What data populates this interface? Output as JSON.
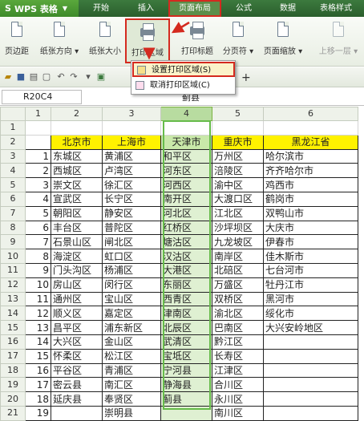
{
  "app": {
    "logo": "S",
    "name": "WPS 表格"
  },
  "menu_tabs": [
    "开始",
    "插入",
    "页面布局",
    "公式",
    "数据",
    "表格样式"
  ],
  "ribbon": {
    "buttons": [
      {
        "name": "page-margin",
        "label": "页边距"
      },
      {
        "name": "paper-orientation",
        "label": "纸张方向"
      },
      {
        "name": "paper-size",
        "label": "纸张大小"
      },
      {
        "name": "print-area",
        "label": "打印区域"
      },
      {
        "name": "print-title",
        "label": "打印标题"
      },
      {
        "name": "page-break",
        "label": "分页符"
      },
      {
        "name": "page-zoom",
        "label": "页面缩放"
      },
      {
        "name": "move-up",
        "label": "上移一层"
      }
    ]
  },
  "dropdown": {
    "set_area": "设置打印区域(S)",
    "cancel_area": "取消打印区域(C)"
  },
  "toolbar": {
    "tab_plus": "+"
  },
  "formula_bar": {
    "name_box": "R20C4",
    "value": "蓟县"
  },
  "sheet": {
    "col_headers": [
      "1",
      "2",
      "3",
      "4",
      "5",
      "6"
    ],
    "header_row": [
      "北京市",
      "上海市",
      "天津市",
      "重庆市",
      "黑龙江省"
    ],
    "rows": [
      [
        "1",
        "东城区",
        "黄浦区",
        "和平区",
        "万州区",
        "哈尔滨市"
      ],
      [
        "2",
        "西城区",
        "卢湾区",
        "河东区",
        "涪陵区",
        "齐齐哈尔市"
      ],
      [
        "3",
        "崇文区",
        "徐汇区",
        "河西区",
        "渝中区",
        "鸡西市"
      ],
      [
        "4",
        "宣武区",
        "长宁区",
        "南开区",
        "大渡口区",
        "鹤岗市"
      ],
      [
        "5",
        "朝阳区",
        "静安区",
        "河北区",
        "江北区",
        "双鸭山市"
      ],
      [
        "6",
        "丰台区",
        "普陀区",
        "红桥区",
        "沙坪坝区",
        "大庆市"
      ],
      [
        "7",
        "石景山区",
        "闸北区",
        "塘沽区",
        "九龙坡区",
        "伊春市"
      ],
      [
        "8",
        "海淀区",
        "虹口区",
        "汉沽区",
        "南岸区",
        "佳木斯市"
      ],
      [
        "9",
        "门头沟区",
        "杨浦区",
        "大港区",
        "北碚区",
        "七台河市"
      ],
      [
        "10",
        "房山区",
        "闵行区",
        "东丽区",
        "万盛区",
        "牡丹江市"
      ],
      [
        "11",
        "通州区",
        "宝山区",
        "西青区",
        "双桥区",
        "黑河市"
      ],
      [
        "12",
        "顺义区",
        "嘉定区",
        "津南区",
        "渝北区",
        "绥化市"
      ],
      [
        "13",
        "昌平区",
        "浦东新区",
        "北辰区",
        "巴南区",
        "大兴安岭地区"
      ],
      [
        "14",
        "大兴区",
        "金山区",
        "武清区",
        "黔江区",
        ""
      ],
      [
        "15",
        "怀柔区",
        "松江区",
        "宝坻区",
        "长寿区",
        ""
      ],
      [
        "16",
        "平谷区",
        "青浦区",
        "宁河县",
        "江津区",
        ""
      ],
      [
        "17",
        "密云县",
        "南汇区",
        "静海县",
        "合川区",
        ""
      ],
      [
        "18",
        "延庆县",
        "奉贤区",
        "蓟县",
        "永川区",
        ""
      ],
      [
        "19",
        "",
        "崇明县",
        "",
        "南川区",
        ""
      ]
    ],
    "row_headers": [
      "1",
      "2",
      "3",
      "4",
      "5",
      "6",
      "7",
      "8",
      "9",
      "10",
      "11",
      "12",
      "13",
      "14",
      "15",
      "16",
      "17",
      "18",
      "19",
      "20",
      "21"
    ]
  },
  "colors": {
    "title_green": "#2a5e2c",
    "highlight_red": "#d42a1f",
    "header_yellow": "#fff200",
    "selected_col": "#dff0d2"
  }
}
